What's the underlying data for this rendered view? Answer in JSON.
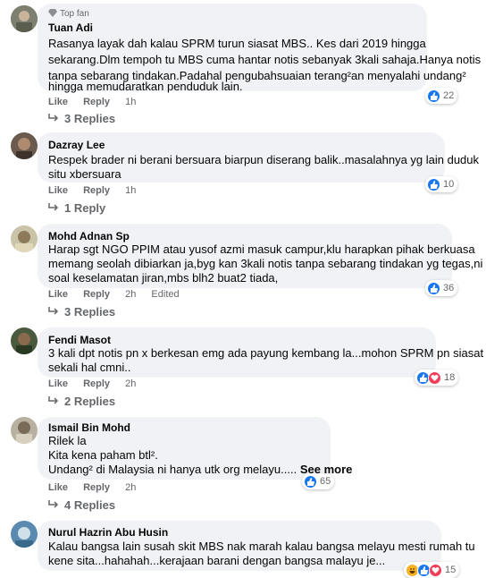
{
  "comments": [
    {
      "badge": "Top fan",
      "author": "Tuan Adi",
      "lines": [
        "Rasanya layak dah kalau SPRM turun siasat MBS.. Kes dari 2019 hingga",
        "sekarang.Dlm tempoh tu MBS cuma hantar notis sebanyak 3kali sahaja.Hanya notis",
        "tanpa sebarang tindakan.Padahal pengubahsuaian terang²an menyalahi undang²",
        "hingga memudaratkan penduduk lain."
      ],
      "like": "Like",
      "reply": "Reply",
      "time": "1h",
      "edited": "",
      "reactions": [
        "like"
      ],
      "reaction_count": "22",
      "replies": "3 Replies"
    },
    {
      "author": "Dazray Lee",
      "lines": [
        "Respek brader ni berani bersuara biarpun diserang balik..masalahnya yg lain duduk",
        "situ xbersuara"
      ],
      "like": "Like",
      "reply": "Reply",
      "time": "1h",
      "edited": "",
      "reactions": [
        "like"
      ],
      "reaction_count": "10",
      "replies": "1 Reply"
    },
    {
      "author": "Mohd Adnan Sp",
      "lines": [
        "Harap sgt NGO PPIM atau yusof azmi masuk campur,klu harapkan pihak berkuasa",
        "memang seolah dibiarkan ja,byg kan 3kali notis tanpa sebarang tindakan yg tegas,ni",
        "soal keselamatan jiran,mbs blh2 buat2 tiada,"
      ],
      "like": "Like",
      "reply": "Reply",
      "time": "2h",
      "edited": "Edited",
      "reactions": [
        "like"
      ],
      "reaction_count": "36",
      "replies": "3 Replies"
    },
    {
      "author": "Fendi Masot",
      "lines": [
        "3 kali dpt notis pn x berkesan emg ada payung kembang la...mohon SPRM pn siasat",
        "sekali hal cmni.."
      ],
      "like": "Like",
      "reply": "Reply",
      "time": "2h",
      "edited": "",
      "reactions": [
        "like",
        "love"
      ],
      "reaction_count": "18",
      "replies": "2 Replies"
    },
    {
      "author": "Ismail Bin Mohd",
      "lines": [
        "Rilek la",
        "Kita kena paham btl².",
        "Undang² di Malaysia ni hanya utk org melayu....."
      ],
      "see_more": "See more",
      "like": "Like",
      "reply": "Reply",
      "time": "2h",
      "edited": "",
      "reactions": [
        "like"
      ],
      "reaction_count": "65",
      "replies": "4 Replies"
    },
    {
      "author": "Nurul Hazrin Abu Husin",
      "lines": [
        "Kalau bangsa lain susah skit MBS nak marah kalau bangsa melayu mesti rumah tu",
        "kene sita...hahahah...kerajaan barani dengan bangsa malayu je..."
      ],
      "like": "Like",
      "reply": "Reply",
      "time": "2h",
      "edited": "",
      "reactions": [
        "haha",
        "like",
        "love"
      ],
      "reaction_count": "15",
      "replies": ""
    }
  ],
  "colors": {
    "bubble": "#f0f2f5",
    "like": "#1877f2",
    "love": "#f33e58",
    "haha": "#f7b125",
    "meta": "#65676b"
  }
}
